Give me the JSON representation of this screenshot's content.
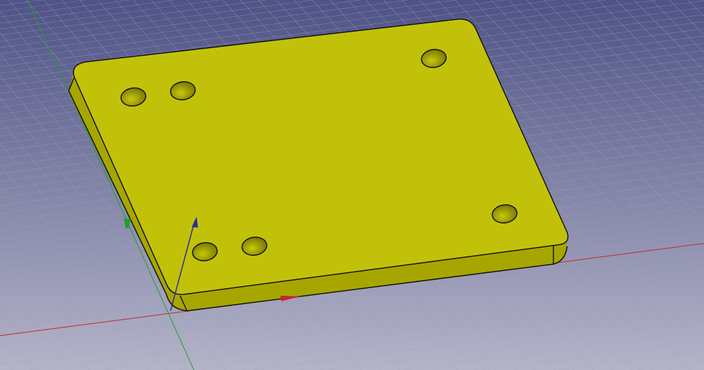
{
  "viewport": {
    "type": "3d-cad-view",
    "background_top": "#4f5385",
    "background_bottom": "#b4b4c8",
    "grid_color": "#9ea2c4"
  },
  "model": {
    "name": "plate",
    "face_color": "#c2c10a",
    "side_color": "#a7a600",
    "edge_color": "#111111",
    "hole_count": 6
  },
  "axes": {
    "x_color": "#c0282a",
    "y_color": "#1fa02a",
    "z_color": "#2a2aa0",
    "icons": [
      "x-axis-arrow-icon",
      "y-axis-arrow-icon",
      "z-axis-arrow-icon"
    ]
  }
}
